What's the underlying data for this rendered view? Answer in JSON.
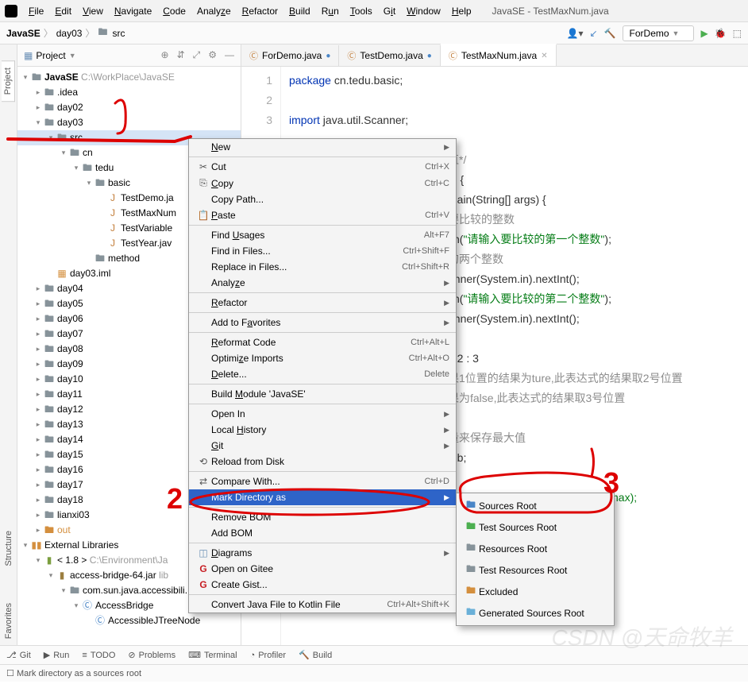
{
  "window_title": "JavaSE - TestMaxNum.java",
  "menubar": [
    "File",
    "Edit",
    "View",
    "Navigate",
    "Code",
    "Analyze",
    "Refactor",
    "Build",
    "Run",
    "Tools",
    "Git",
    "Window",
    "Help"
  ],
  "breadcrumb": {
    "root": "JavaSE",
    "p1": "day03",
    "p2": "src"
  },
  "run_config": "ForDemo",
  "project_panel_title": "Project",
  "tree": {
    "root": "JavaSE",
    "root_path": "C:\\WorkPlace\\JavaSE",
    "idea": ".idea",
    "day02": "day02",
    "day03": "day03",
    "src": "src",
    "cn": "cn",
    "tedu": "tedu",
    "basic": "basic",
    "testdemo": "TestDemo.ja",
    "testmax": "TestMaxNum",
    "testvar": "TestVariable",
    "testyear": "TestYear.jav",
    "method": "method",
    "iml": "day03.iml",
    "day04": "day04",
    "day05": "day05",
    "day06": "day06",
    "day07": "day07",
    "day08": "day08",
    "day09": "day09",
    "day10": "day10",
    "day11": "day11",
    "day12": "day12",
    "day13": "day13",
    "day14": "day14",
    "day15": "day15",
    "day16": "day16",
    "day17": "day17",
    "day18": "day18",
    "lianxi": "lianxi03",
    "out": "out",
    "extlib": "External Libraries",
    "jdk": "< 1.8 >",
    "jdk_path": "C:\\Environment\\Ja",
    "jar": "access-bridge-64.jar",
    "jar_path": "lib",
    "pkg": "com.sun.java.accessibili...",
    "ab": "AccessBridge",
    "abtree": "AccessibleJTreeNode"
  },
  "tabs": [
    {
      "label": "ForDemo.java",
      "modified": true
    },
    {
      "label": "TestDemo.java",
      "modified": true
    },
    {
      "label": "TestMaxNum.java",
      "modified": false,
      "active": true
    }
  ],
  "code_lines": [
    "1",
    "2",
    "3"
  ],
  "code": {
    "l1_kw": "package",
    "l1_rest": " cn.tedu.basic;",
    "l3_kw": "import",
    "l3_rest": " java.util.Scanner;",
    "cm1": "直*/",
    "cls_kw": "m {",
    "main": " main(String[] args) {",
    "cm2": "要比较的整数",
    "print1_a": "tln(",
    "print1_s": "\"请输入要比较的第一个整数\"",
    "print1_b": ");",
    "cm3": "的两个整数",
    "scan1": "anner(System.in).nextInt();",
    "print2_s": "\"请输入要比较的第二个整数\"",
    "scan2": "anner(System.in).nextInt();",
    "tern": "? 2 : 3",
    "cm4": "果1位置的结果为ture,此表达式的结果取2号位置",
    "cm5": "果为false,此表达式的结果取3号位置",
    "cm6": "量来保存最大值",
    "ab": "a:b;",
    "print3_s": "\"+max);"
  },
  "context_menu": {
    "new": "New",
    "cut": "Cut",
    "cut_sc": "Ctrl+X",
    "copy": "Copy",
    "copy_sc": "Ctrl+C",
    "copypath": "Copy Path...",
    "paste": "Paste",
    "paste_sc": "Ctrl+V",
    "findusages": "Find Usages",
    "findusages_sc": "Alt+F7",
    "findinfiles": "Find in Files...",
    "findinfiles_sc": "Ctrl+Shift+F",
    "replaceinfiles": "Replace in Files...",
    "replaceinfiles_sc": "Ctrl+Shift+R",
    "analyze": "Analyze",
    "refactor": "Refactor",
    "addfav": "Add to Favorites",
    "reformat": "Reformat Code",
    "reformat_sc": "Ctrl+Alt+L",
    "optimize": "Optimize Imports",
    "optimize_sc": "Ctrl+Alt+O",
    "delete": "Delete...",
    "delete_sc": "Delete",
    "build": "Build Module 'JavaSE'",
    "openin": "Open In",
    "localhist": "Local History",
    "git": "Git",
    "reload": "Reload from Disk",
    "compare": "Compare With...",
    "compare_sc": "Ctrl+D",
    "markdir": "Mark Directory as",
    "removebom": "Remove BOM",
    "addbom": "Add BOM",
    "diagrams": "Diagrams",
    "gitee": "Open on Gitee",
    "gist": "Create Gist...",
    "kotlin": "Convert Java File to Kotlin File",
    "kotlin_sc": "Ctrl+Alt+Shift+K"
  },
  "submenu": {
    "sources": "Sources Root",
    "testsources": "Test Sources Root",
    "resources": "Resources Root",
    "testresources": "Test Resources Root",
    "excluded": "Excluded",
    "generated": "Generated Sources Root"
  },
  "bottom_tabs": {
    "git": "Git",
    "run": "Run",
    "todo": "TODO",
    "problems": "Problems",
    "terminal": "Terminal",
    "profiler": "Profiler",
    "build": "Build"
  },
  "status_text": "Mark directory as a sources root",
  "side_tabs": {
    "project": "Project",
    "structure": "Structure",
    "favorites": "Favorites"
  },
  "watermark": "CSDN @天命牧羊"
}
